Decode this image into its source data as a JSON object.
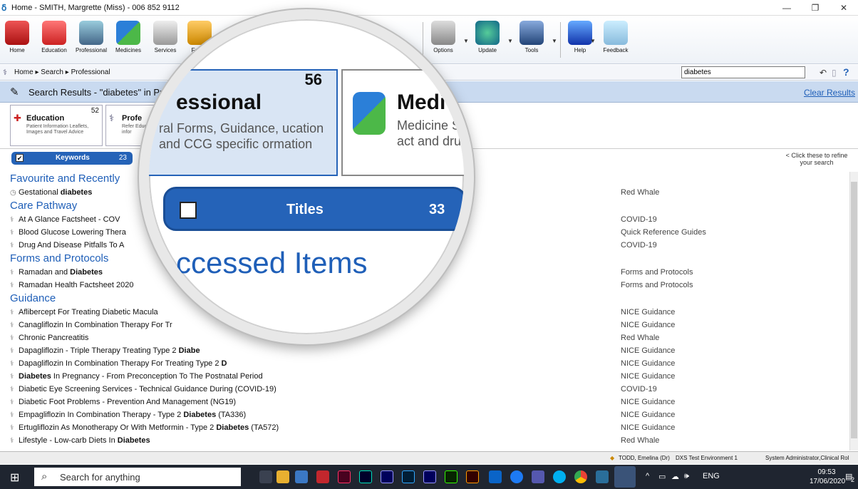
{
  "window": {
    "title": "Home - SMITH, Margrette (Miss) - 006 852 9112",
    "logo": "DXS"
  },
  "ribbon": {
    "buttons": [
      {
        "label": "Home",
        "icon": "home-icon"
      },
      {
        "label": "Education",
        "icon": "education-icon"
      },
      {
        "label": "Professional",
        "icon": "professional-icon"
      },
      {
        "label": "Medicines",
        "icon": "medicines-icon"
      },
      {
        "label": "Services",
        "icon": "services-icon"
      },
      {
        "label": "Forms",
        "icon": "forms-icon"
      }
    ],
    "right_buttons": [
      {
        "label": "Options",
        "icon": "options-icon"
      },
      {
        "label": "Update",
        "icon": "update-icon"
      },
      {
        "label": "Tools",
        "icon": "tools-icon"
      },
      {
        "label": "Help",
        "icon": "help-icon"
      },
      {
        "label": "Feedback",
        "icon": "feedback-icon"
      }
    ]
  },
  "breadcrumb": {
    "items": [
      "Home",
      "Search",
      "Professional"
    ],
    "sep": "▸"
  },
  "search": {
    "value": "diabetes"
  },
  "results": {
    "title": "Search Results - \"diabetes\" in Pr",
    "clear": "Clear Results"
  },
  "categories": [
    {
      "name": "Education",
      "count": "52",
      "desc": "Patient Information Leaflets, Images and Travel Advice"
    },
    {
      "name": "Profe",
      "desc": "Refer Educ infor"
    }
  ],
  "filter": {
    "keywords_label": "Keywords",
    "keywords_count": "23",
    "hint": "< Click these to refine your search"
  },
  "list": [
    {
      "type": "section",
      "text": "Favourite and Recently"
    },
    {
      "type": "item",
      "pre": "Gestational ",
      "bold": "diabetes",
      "post": "",
      "source": "Red Whale",
      "icon": "clock-icon"
    },
    {
      "type": "section",
      "text": "Care Pathway"
    },
    {
      "type": "item",
      "pre": "At A Glance Factsheet - COV",
      "bold": "",
      "post": "",
      "source": "COVID-19",
      "icon": "caduceus-icon"
    },
    {
      "type": "item",
      "pre": "Blood Glucose Lowering Thera",
      "bold": "",
      "post": "",
      "source": "Quick Reference Guides",
      "icon": "caduceus-icon"
    },
    {
      "type": "item",
      "pre": "Drug And Disease Pitfalls To A",
      "bold": "",
      "post": "",
      "source": "COVID-19",
      "icon": "caduceus-icon"
    },
    {
      "type": "section",
      "text": "Forms and Protocols"
    },
    {
      "type": "item",
      "pre": "Ramadan and ",
      "bold": "Diabetes",
      "post": "",
      "source": "Forms and Protocols",
      "icon": "caduceus-icon"
    },
    {
      "type": "item",
      "pre": "Ramadan Health Factsheet 2020",
      "bold": "",
      "post": "",
      "source": "Forms and Protocols",
      "icon": "caduceus-icon"
    },
    {
      "type": "section",
      "text": "Guidance"
    },
    {
      "type": "item",
      "pre": "Aflibercept For Treating Diabetic Macula",
      "bold": "",
      "post": "",
      "source": "NICE Guidance",
      "icon": "caduceus-icon"
    },
    {
      "type": "item",
      "pre": "Canagliflozin In Combination Therapy For Tr",
      "bold": "",
      "post": "",
      "source": "NICE Guidance",
      "icon": "caduceus-icon"
    },
    {
      "type": "item",
      "pre": "Chronic Pancreatitis",
      "bold": "",
      "post": "",
      "source": "Red Whale",
      "icon": "caduceus-icon"
    },
    {
      "type": "item",
      "pre": "Dapagliflozin - Triple Therapy Treating Type 2 ",
      "bold": "Diabe",
      "post": "",
      "source": "NICE Guidance",
      "icon": "caduceus-icon"
    },
    {
      "type": "item",
      "pre": "Dapagliflozin In Combination Therapy For Treating Type 2 ",
      "bold": "D",
      "post": "",
      "source": "NICE Guidance",
      "icon": "caduceus-icon"
    },
    {
      "type": "item",
      "pre": "",
      "bold": "Diabetes",
      "post": " In Pregnancy - From Preconception To The Postnatal Period",
      "source": "NICE Guidance",
      "icon": "caduceus-icon"
    },
    {
      "type": "item",
      "pre": "Diabetic Eye Screening Services - Technical Guidance During (COVID-19)",
      "bold": "",
      "post": "",
      "source": "COVID-19",
      "icon": "caduceus-icon"
    },
    {
      "type": "item",
      "pre": "Diabetic Foot Problems - Prevention And Management (NG19)",
      "bold": "",
      "post": "",
      "source": "NICE Guidance",
      "icon": "caduceus-icon"
    },
    {
      "type": "item",
      "pre": "Empagliflozin In Combination Therapy -  Type 2 ",
      "bold": "Diabetes",
      "post": " (TA336)",
      "source": "NICE Guidance",
      "icon": "caduceus-icon"
    },
    {
      "type": "item",
      "pre": "Ertugliflozin As Monotherapy Or With Metformin - Type 2 ",
      "bold": "Diabetes",
      "post": " (TA572)",
      "source": "NICE Guidance",
      "icon": "caduceus-icon"
    },
    {
      "type": "item",
      "pre": "Lifestyle - Low-carb Diets In ",
      "bold": "Diabetes",
      "post": "",
      "source": "Red Whale",
      "icon": "caduceus-icon"
    }
  ],
  "status": {
    "user": "TODD, Emelina (Dr)",
    "env": "DXS Test Environment 1",
    "role": "System Administrator,Clinical Rol"
  },
  "taskbar": {
    "search_placeholder": "Search for anything",
    "lang": "ENG",
    "time": "09:53",
    "date": "17/06/2020",
    "notif": "2"
  },
  "magnifier": {
    "card1_name": "essional",
    "card1_count": "56",
    "card1_desc": "ral Forms, Guidance, ucation and CCG specific ormation",
    "card2_name": "Medi",
    "card2_desc": "Medicine SPC's, act and drug cla",
    "pill_label": "Titles",
    "pill_count": "33",
    "section": "Accessed Items",
    "fragment": "iabetes"
  },
  "colors": {
    "accent": "#2563b8",
    "link": "#1f5fb8",
    "resbar": "#c9daf0"
  }
}
